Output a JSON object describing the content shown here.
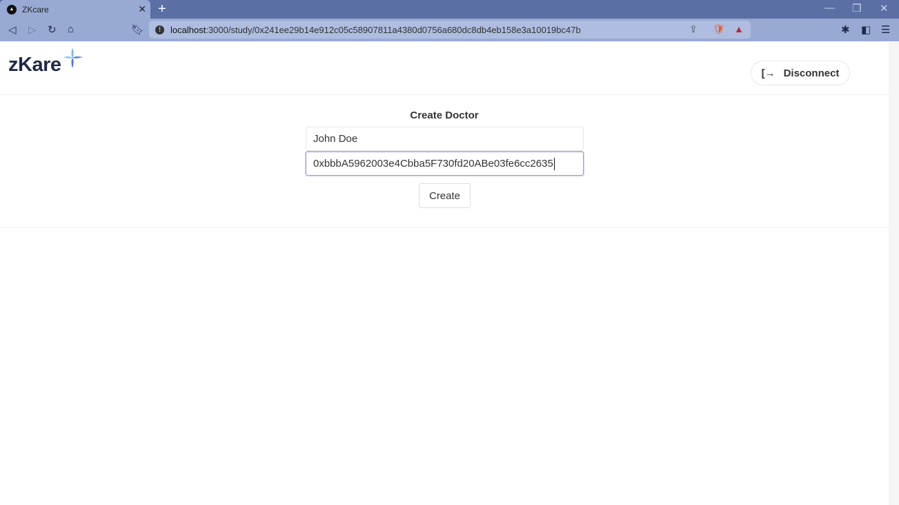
{
  "browser": {
    "tab_title": "ZKcare",
    "url_host": "localhost",
    "url_path": ":3000/study/0x241ee29b14e912c05c58907811a4380d0756a680dc8db4eb158e3a10019bc47b"
  },
  "header": {
    "logo_text": "zKare",
    "disconnect_label": "Disconnect"
  },
  "form": {
    "title": "Create Doctor",
    "name_value": "John Doe",
    "address_value": "0xbbbA5962003e4Cbba5F730fd20ABe03fe6cc2635",
    "create_label": "Create"
  }
}
